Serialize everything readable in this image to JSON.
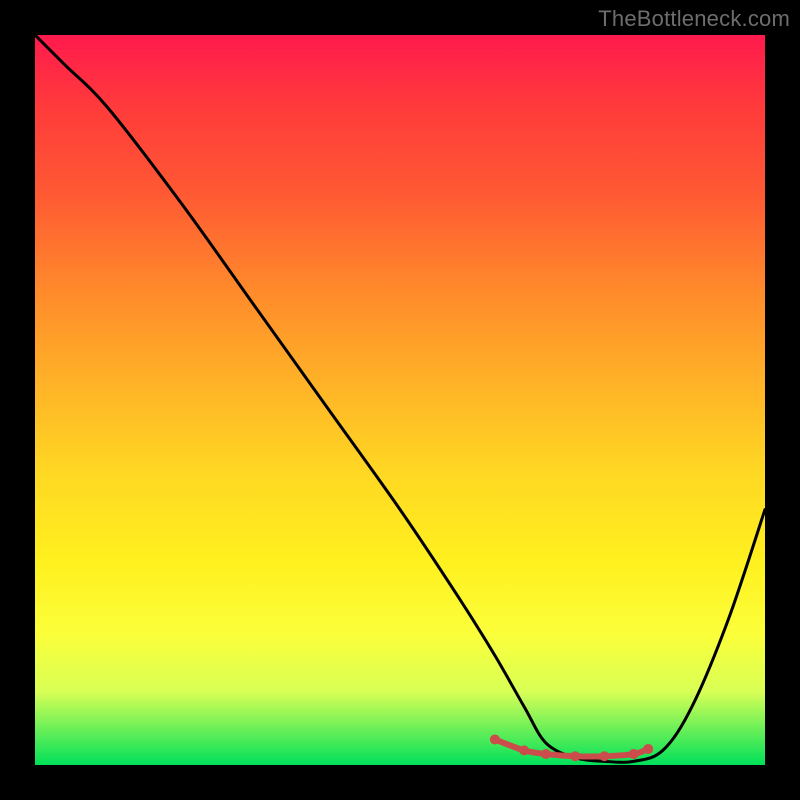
{
  "watermark": "TheBottleneck.com",
  "chart_data": {
    "type": "line",
    "title": "",
    "xlabel": "",
    "ylabel": "",
    "xlim": [
      0,
      100
    ],
    "ylim": [
      0,
      100
    ],
    "x": [
      0,
      4,
      10,
      20,
      30,
      40,
      50,
      58,
      63,
      67,
      70,
      74,
      78,
      82,
      86,
      90,
      95,
      100
    ],
    "values": [
      100,
      96,
      90,
      77,
      63,
      49,
      35,
      23,
      15,
      8,
      3,
      1,
      0.5,
      0.5,
      2,
      8,
      20,
      35
    ],
    "marker_region": {
      "x": [
        63,
        67,
        70,
        74,
        78,
        82,
        84
      ],
      "values": [
        3.5,
        2,
        1.5,
        1.2,
        1.2,
        1.5,
        2.2
      ]
    },
    "colors": {
      "curve": "#000000",
      "markers": "#cc4c4c",
      "gradient_top": "#ff1a4d",
      "gradient_bottom": "#00e05a"
    }
  }
}
